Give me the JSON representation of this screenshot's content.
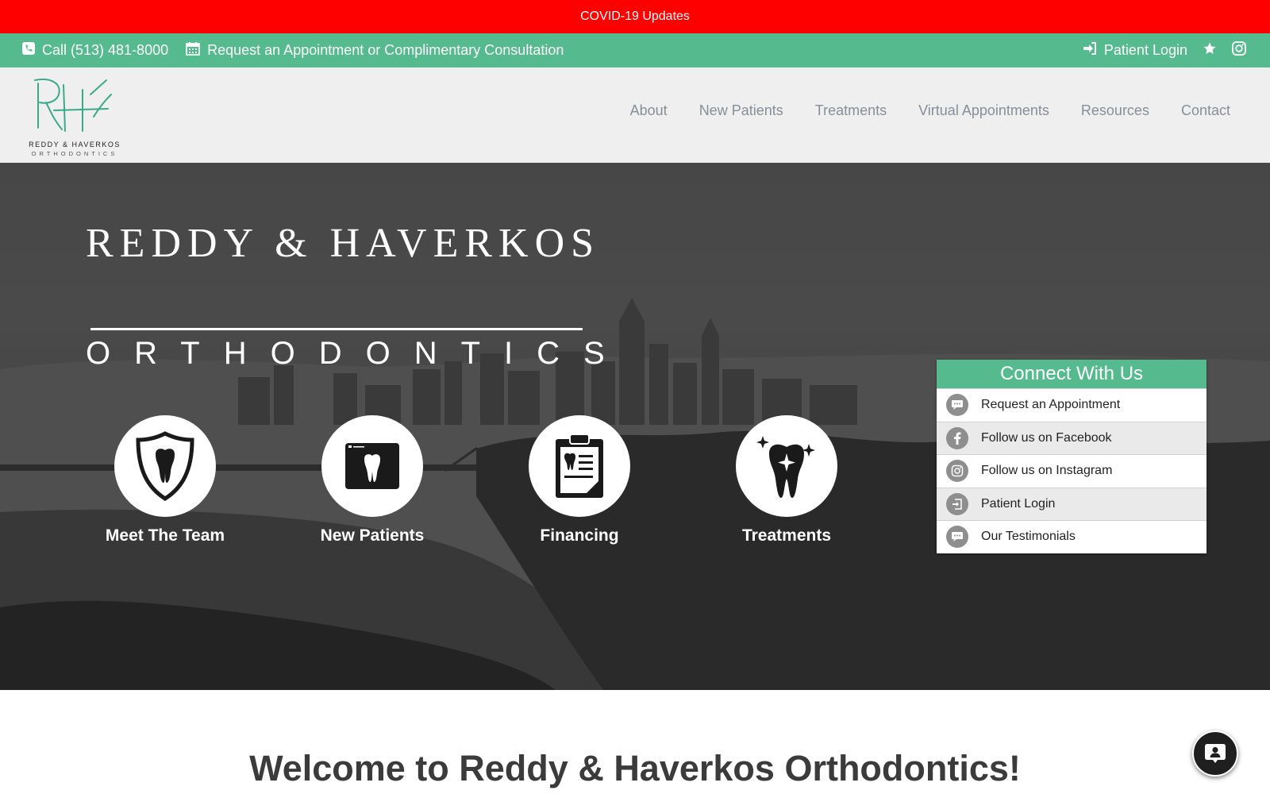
{
  "covid_bar": {
    "label": "COVID-19 Updates",
    "color": "#ff0000"
  },
  "contact_bar": {
    "color": "#55bb8f",
    "phone": {
      "icon": "phone-icon",
      "label": "Call (513) 481-8000"
    },
    "appointment": {
      "icon": "calendar-icon",
      "label": "Request an Appointment or Complimentary Consultation"
    },
    "patient_login": {
      "icon": "sign-in-icon",
      "label": "Patient Login"
    },
    "star_icon": "star-icon",
    "instagram_icon": "instagram-icon"
  },
  "header": {
    "logo_monogram": "RH",
    "logo_name": "REDDY & HAVERKOS",
    "logo_sub": "ORTHODONTICS",
    "nav": [
      "About",
      "New Patients",
      "Treatments",
      "Virtual Appointments",
      "Resources",
      "Contact"
    ]
  },
  "hero": {
    "title_line1": "REDDY & HAVERKOS",
    "title_line2": "ORTHODONTICS",
    "links": [
      {
        "icon": "tooth-shield-icon",
        "label": "Meet The Team"
      },
      {
        "icon": "tooth-screen-icon",
        "label": "New Patients"
      },
      {
        "icon": "clipboard-tooth-icon",
        "label": "Financing"
      },
      {
        "icon": "sparkle-tooth-icon",
        "label": "Treatments"
      }
    ]
  },
  "connect": {
    "title": "Connect With Us",
    "items": [
      {
        "icon": "chat-icon",
        "label": "Request an Appointment"
      },
      {
        "icon": "facebook-icon",
        "label": "Follow us on Facebook"
      },
      {
        "icon": "instagram-icon",
        "label": "Follow us on Instagram"
      },
      {
        "icon": "login-icon",
        "label": "Patient Login"
      },
      {
        "icon": "chat-icon",
        "label": "Our Testimonials"
      }
    ]
  },
  "welcome": {
    "heading": "Welcome to Reddy & Haverkos Orthodontics!"
  },
  "chat_widget": {
    "icon": "chat-contact-icon"
  }
}
